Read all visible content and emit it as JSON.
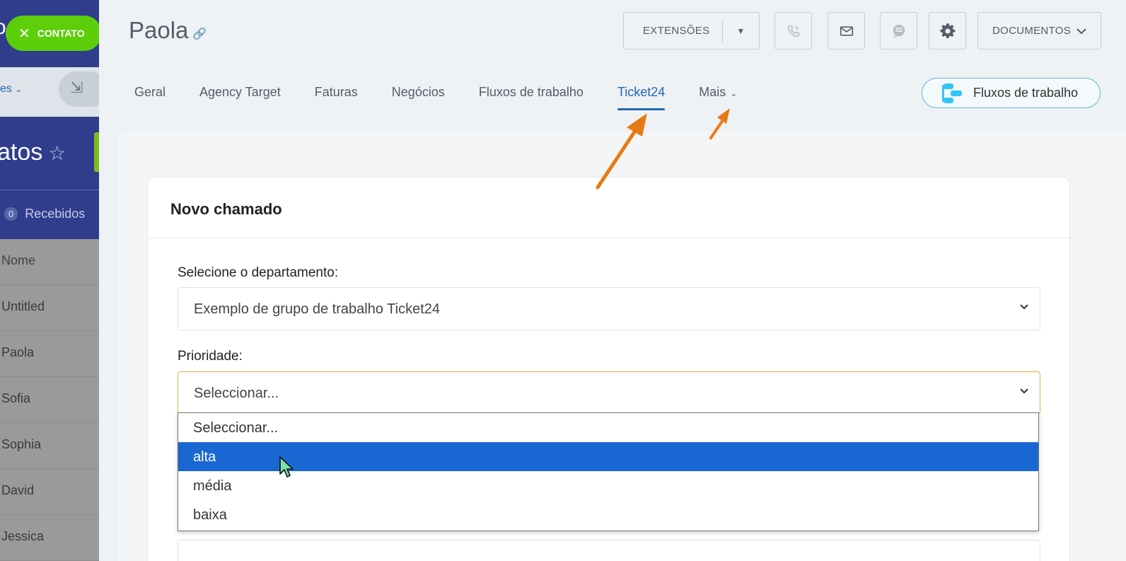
{
  "background_app": {
    "contato_label": "CONTATO",
    "nav_link": "es",
    "title": "atos",
    "received_label": "Recebidos",
    "received_count": "0",
    "list_header": "Nome",
    "list_rows": [
      "Untitled",
      "Paola",
      "Sofia",
      "Sophia",
      "David",
      "Jessica"
    ]
  },
  "header": {
    "entity_name": "Paola",
    "extensions_label": "EXTENSÕES",
    "documents_label": "DOCUMENTOS",
    "icons": [
      "phone-icon",
      "mail-icon",
      "chat-icon",
      "gear-icon"
    ]
  },
  "tabs": [
    {
      "label": "Geral",
      "active": false
    },
    {
      "label": "Agency Target",
      "active": false
    },
    {
      "label": "Faturas",
      "active": false
    },
    {
      "label": "Negócios",
      "active": false
    },
    {
      "label": "Fluxos de trabalho",
      "active": false
    },
    {
      "label": "Ticket24",
      "active": true
    },
    {
      "label": "Mais",
      "active": false
    }
  ],
  "workflow_button": "Fluxos de trabalho",
  "form": {
    "title": "Novo chamado",
    "department_label": "Selecione o departamento:",
    "department_value": "Exemplo de grupo de trabalho Ticket24",
    "priority_label": "Prioridade:",
    "priority_value": "Seleccionar...",
    "priority_options": [
      "Seleccionar...",
      "alta",
      "média",
      "baixa"
    ],
    "highlighted_option": "alta"
  },
  "colors": {
    "accent": "#2066b0",
    "highlight": "#1967d2",
    "annotation_arrow": "#e87a16",
    "contato_green": "#5ccf0a",
    "workflow_icon": "#2fc6f6"
  }
}
